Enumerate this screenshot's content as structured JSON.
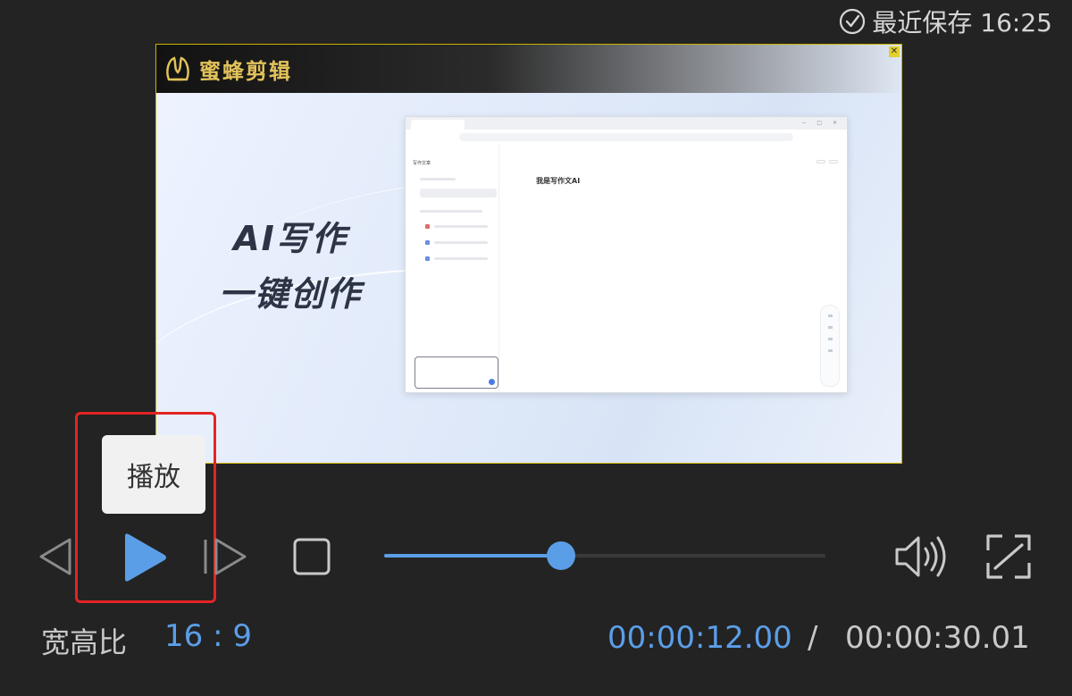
{
  "header": {
    "save_status": "最近保存 16:25",
    "save_icon": "check-circle-icon"
  },
  "preview": {
    "logo_text": "蜜蜂剪辑",
    "headline_line1": "AI写作",
    "headline_line2": "一键创作",
    "screen": {
      "sidebar_title": "写作文章",
      "heading": "我是写作文AI"
    }
  },
  "controls": {
    "tooltip": "播放",
    "prev_icon": "previous-frame-icon",
    "play_icon": "play-icon",
    "next_icon": "next-frame-icon",
    "stop_icon": "stop-icon",
    "volume_icon": "volume-icon",
    "fullscreen_icon": "fullscreen-icon",
    "progress": 0.4,
    "accent_color": "#5b9ee8",
    "highlight_color": "#e32424"
  },
  "footer": {
    "aspect_label": "宽高比",
    "aspect_value": "16 : 9",
    "current_time": "00:00:12.00",
    "separator": "/",
    "total_time": "00:00:30.01"
  }
}
